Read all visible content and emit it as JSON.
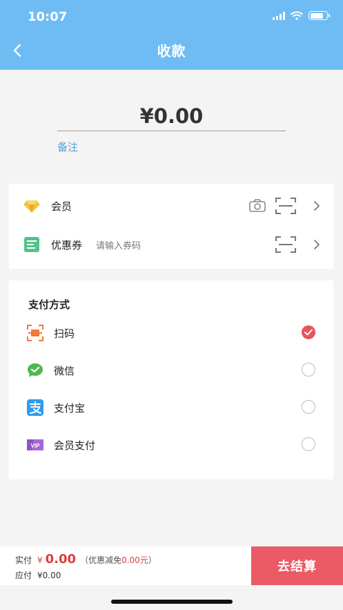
{
  "status_bar": {
    "time": "10:07"
  },
  "nav": {
    "title": "收款"
  },
  "amount": {
    "value": "¥0.00",
    "remark_label": "备注"
  },
  "options": {
    "member_label": "会员",
    "coupon_label": "优惠券",
    "coupon_placeholder": "请输入券码"
  },
  "payment": {
    "title": "支付方式",
    "methods": [
      {
        "label": "扫码",
        "icon": "scan-pay-icon",
        "selected": true
      },
      {
        "label": "微信",
        "icon": "wechat-icon",
        "selected": false
      },
      {
        "label": "支付宝",
        "icon": "alipay-icon",
        "selected": false
      },
      {
        "label": "会员支付",
        "icon": "vip-icon",
        "selected": false
      }
    ]
  },
  "summary": {
    "actual_label": "实付",
    "actual_currency": "¥",
    "actual_value": "0.00",
    "discount_prefix": "（优惠减免",
    "discount_value": "0.00元",
    "discount_suffix": "）",
    "due_label": "应付",
    "due_value": "¥0.00"
  },
  "checkout": {
    "label": "去结算"
  },
  "colors": {
    "header": "#6ebcf3",
    "accent_red": "#ea5b66",
    "link_blue": "#4aa3df"
  }
}
